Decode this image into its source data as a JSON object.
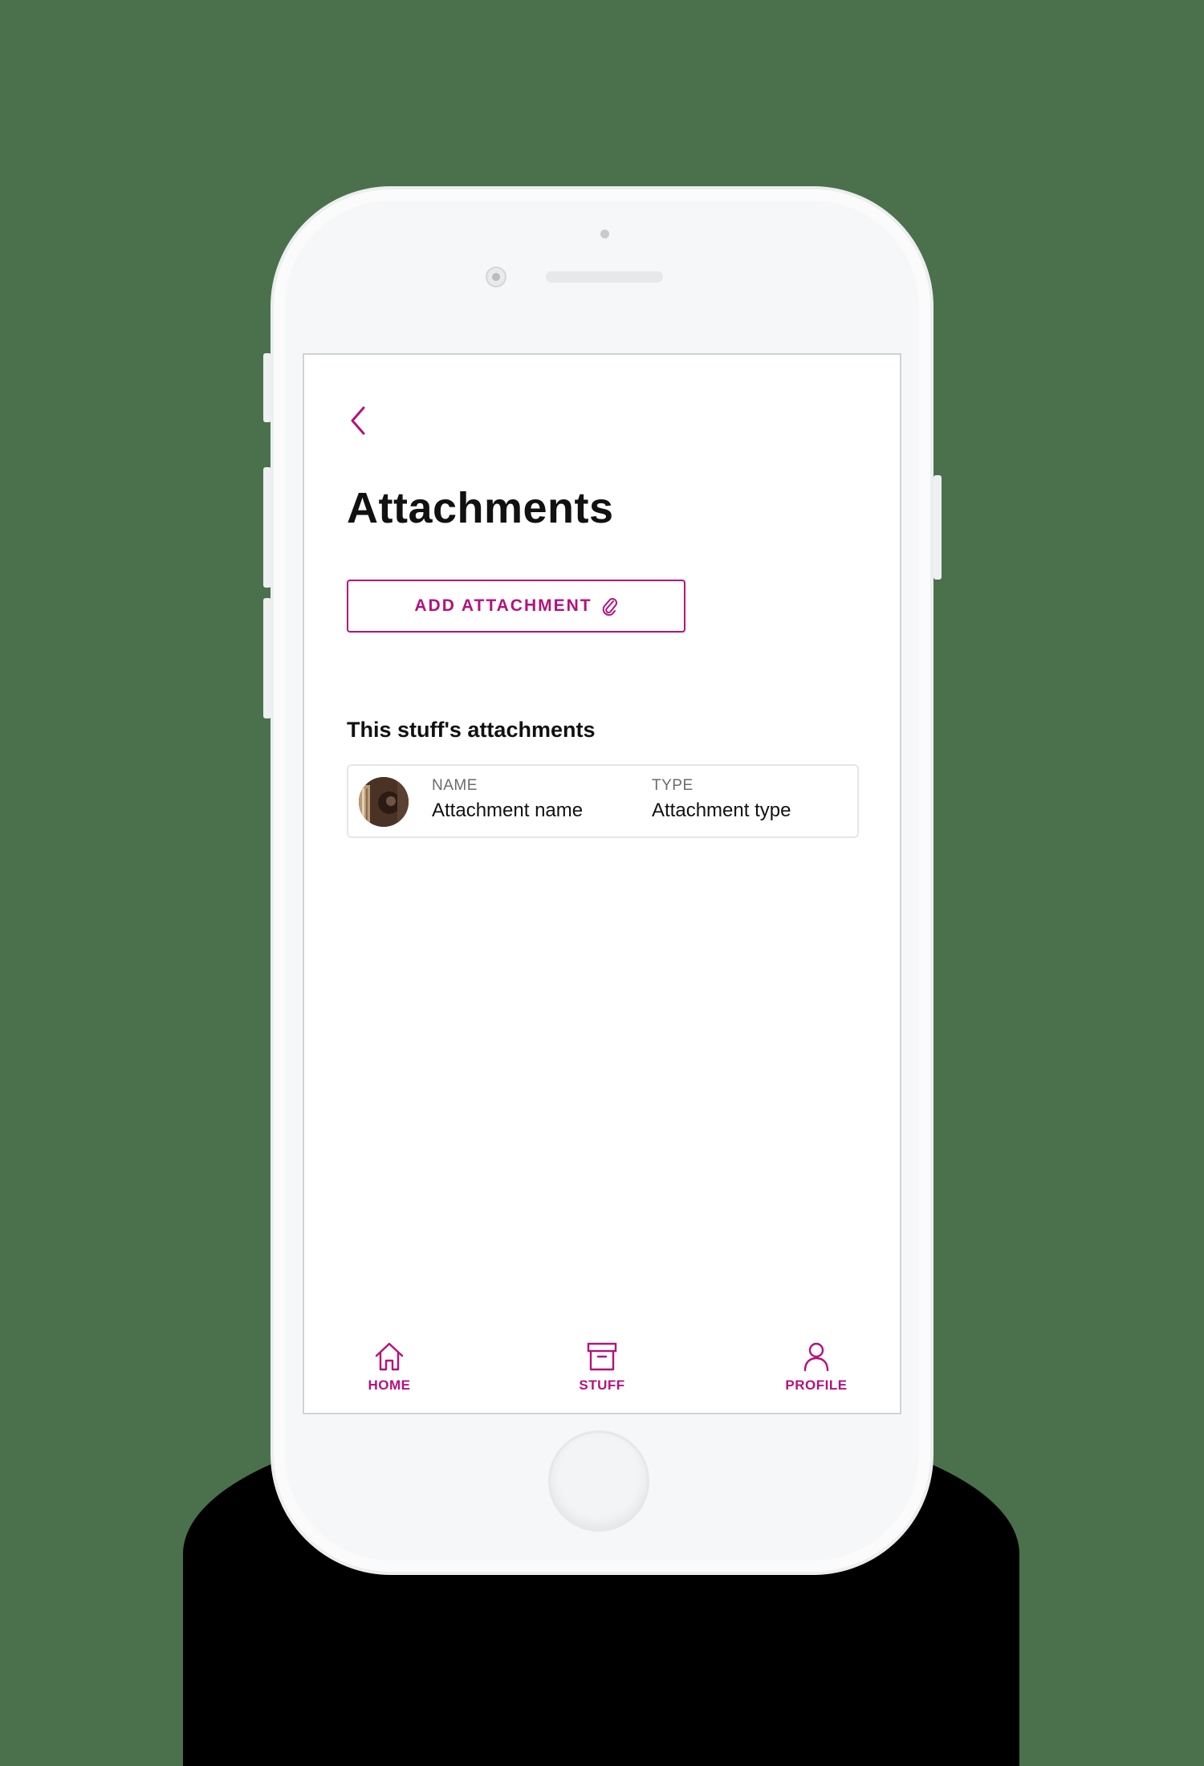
{
  "colors": {
    "accent": "#b5117e",
    "background": "#4a714b",
    "text": "#111111",
    "muted": "#6b6b6b"
  },
  "header": {
    "back_icon": "chevron-left-icon",
    "title": "Attachments"
  },
  "actions": {
    "add_attachment_label": "ADD ATTACHMENT",
    "add_attachment_icon": "paperclip-icon"
  },
  "attachments": {
    "section_title": "This stuff's attachments",
    "items": [
      {
        "name_label": "NAME",
        "name_value": "Attachment name",
        "type_label": "TYPE",
        "type_value": "Attachment type",
        "thumbnail": "photo-thumbnail"
      }
    ]
  },
  "tabbar": {
    "items": [
      {
        "label": "HOME",
        "icon": "home-icon"
      },
      {
        "label": "STUFF",
        "icon": "archive-box-icon"
      },
      {
        "label": "PROFILE",
        "icon": "user-icon"
      }
    ]
  }
}
